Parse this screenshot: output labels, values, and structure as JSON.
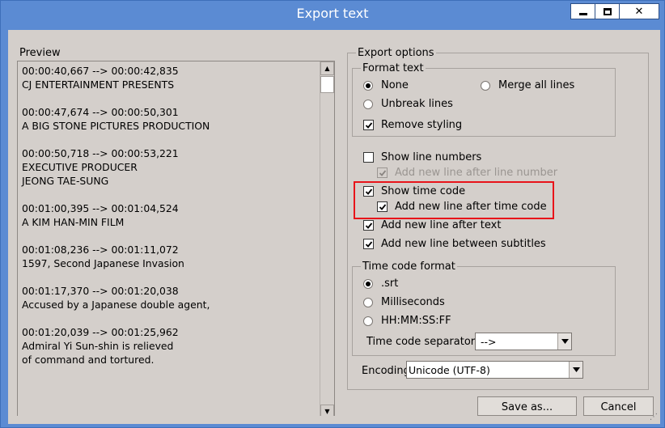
{
  "window": {
    "title": "Export text"
  },
  "preview": {
    "label": "Preview",
    "text": "00:00:40,667 --> 00:00:42,835\nCJ ENTERTAINMENT PRESENTS\n\n00:00:47,674 --> 00:00:50,301\nA BIG STONE PICTURES PRODUCTION\n\n00:00:50,718 --> 00:00:53,221\nEXECUTIVE PRODUCER\nJEONG TAE-SUNG\n\n00:01:00,395 --> 00:01:04,524\nA KIM HAN-MIN FILM\n\n00:01:08,236 --> 00:01:11,072\n1597, Second Japanese Invasion\n\n00:01:17,370 --> 00:01:20,038\nAccused by a Japanese double agent,\n\n00:01:20,039 --> 00:01:25,962\nAdmiral Yi Sun-shin is relieved\nof command and tortured."
  },
  "export_options": {
    "label": "Export options",
    "format_text": {
      "label": "Format text",
      "none": {
        "label": "None",
        "selected": true
      },
      "merge_all_lines": {
        "label": "Merge all lines",
        "selected": false
      },
      "unbreak_lines": {
        "label": "Unbreak lines",
        "selected": false
      },
      "remove_styling": {
        "label": "Remove styling",
        "checked": true
      }
    },
    "show_line_numbers": {
      "label": "Show line numbers",
      "checked": false
    },
    "add_new_line_after_line_number": {
      "label": "Add new line after line number",
      "checked": true,
      "enabled": false
    },
    "show_time_code": {
      "label": "Show time code",
      "checked": true
    },
    "add_new_line_after_time_code": {
      "label": "Add new line after time code",
      "checked": true
    },
    "add_new_line_after_text": {
      "label": "Add new line after text",
      "checked": true
    },
    "add_new_line_between_subtitles": {
      "label": "Add new line between subtitles",
      "checked": true
    },
    "time_code_format": {
      "label": "Time code format",
      "srt": {
        "label": ".srt",
        "selected": true
      },
      "milliseconds": {
        "label": "Milliseconds",
        "selected": false
      },
      "hhmmssff": {
        "label": "HH:MM:SS:FF",
        "selected": false
      },
      "separator_label": "Time code separator",
      "separator_value": "-->"
    },
    "encoding": {
      "label": "Encoding",
      "value": "Unicode (UTF-8)"
    }
  },
  "buttons": {
    "save_as": "Save as...",
    "cancel": "Cancel"
  },
  "colors": {
    "titlebar": "#5b8bd3",
    "client_bg": "#d4cfcb",
    "highlight": "#e8141a"
  }
}
